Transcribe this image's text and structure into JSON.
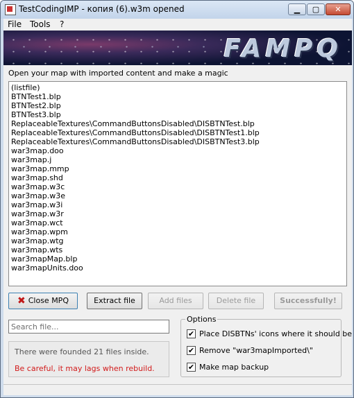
{
  "window": {
    "title": "TestCodingIMP - копия (6).w3m opened"
  },
  "titlebar_buttons": {
    "minimize": "▁",
    "maximize": "▢",
    "close": "✕"
  },
  "menu": {
    "items": [
      "File",
      "Tools",
      "?"
    ]
  },
  "banner": {
    "logo": "FAMPQ"
  },
  "instruction": "Open your map with imported content and make a magic",
  "files": [
    "(listfile)",
    "BTNTest1.blp",
    "BTNTest2.blp",
    "BTNTest3.blp",
    "ReplaceableTextures\\CommandButtonsDisabled\\DISBTNTest.blp",
    "ReplaceableTextures\\CommandButtonsDisabled\\DISBTNTest1.blp",
    "ReplaceableTextures\\CommandButtonsDisabled\\DISBTNTest3.blp",
    "war3map.doo",
    "war3map.j",
    "war3map.mmp",
    "war3map.shd",
    "war3map.w3c",
    "war3map.w3e",
    "war3map.w3i",
    "war3map.w3r",
    "war3map.wct",
    "war3map.wpm",
    "war3map.wtg",
    "war3map.wts",
    "war3mapMap.blp",
    "war3mapUnits.doo"
  ],
  "buttons": {
    "close_mpq": "Close MPQ",
    "close_icon": "✖",
    "extract": "Extract file",
    "add": "Add files",
    "delete": "Delete file",
    "success": "Successfully!"
  },
  "search": {
    "placeholder": "Search file...",
    "value": ""
  },
  "info": {
    "count_text": "There were founded 21 files inside.",
    "warning_text": "Be careful, it may lags when rebuild."
  },
  "options": {
    "legend": "Options",
    "items": [
      {
        "label": "Place DISBTNs' icons where it should be",
        "checked": true
      },
      {
        "label": "Remove \"war3mapImported\\\"",
        "checked": true
      },
      {
        "label": "Make map backup",
        "checked": true
      }
    ]
  },
  "colors": {
    "warning": "#d21a1a",
    "close_icon": "#c01818"
  }
}
